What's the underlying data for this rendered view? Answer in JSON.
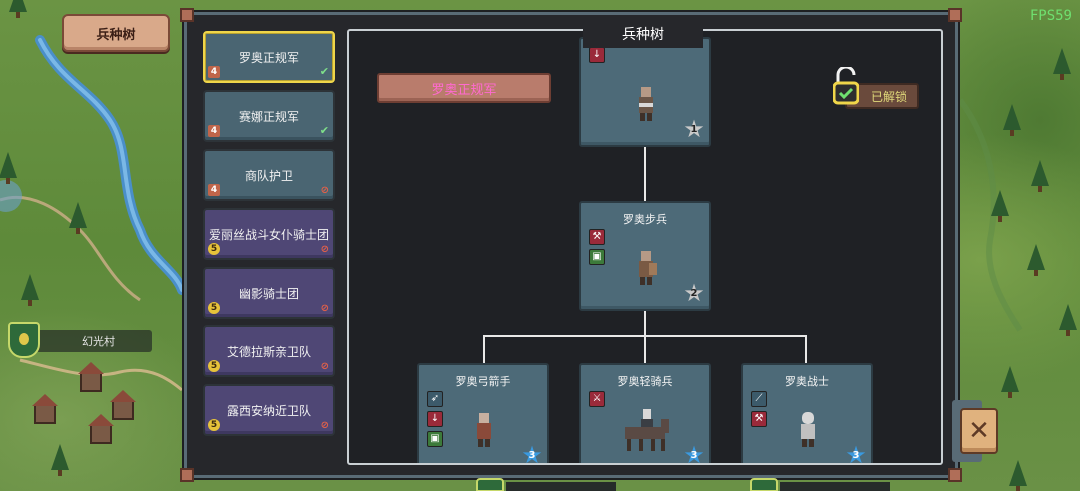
{
  "hud": {
    "top_button": "兵种树",
    "fps": "FPS59"
  },
  "map": {
    "village_name": "幻光村"
  },
  "sidebar": {
    "items": [
      {
        "name": "罗奥正规军",
        "tier": "4",
        "status": "✔",
        "style": "blue",
        "selected": true
      },
      {
        "name": "赛娜正规军",
        "tier": "4",
        "status": "✔",
        "style": "blue",
        "selected": false
      },
      {
        "name": "商队护卫",
        "tier": "4",
        "status": "⊘",
        "style": "blue",
        "selected": false
      },
      {
        "name": "爱丽丝战斗女仆骑士团",
        "tier": "5",
        "status": "⊘",
        "style": "purple",
        "selected": false
      },
      {
        "name": "幽影骑士团",
        "tier": "5",
        "status": "⊘",
        "style": "purple",
        "selected": false
      },
      {
        "name": "艾德拉斯亲卫队",
        "tier": "5",
        "status": "⊘",
        "style": "purple",
        "selected": false
      },
      {
        "name": "露西安纳近卫队",
        "tier": "5",
        "status": "⊘",
        "style": "purple",
        "selected": false
      }
    ]
  },
  "tree": {
    "title": "兵种树",
    "selected_faction": "罗奥正规军",
    "unlock_label": "已解锁",
    "nodes": [
      {
        "name": "",
        "tier": "1",
        "icons": [
          "red"
        ],
        "star": "silver"
      },
      {
        "name": "罗奥步兵",
        "tier": "2",
        "icons": [
          "red",
          "green"
        ],
        "star": "silver"
      },
      {
        "name": "罗奥弓箭手",
        "tier": "3",
        "icons": [
          "slate",
          "red",
          "green"
        ],
        "star": "blue"
      },
      {
        "name": "罗奥轻骑兵",
        "tier": "3",
        "icons": [
          "red"
        ],
        "star": "blue"
      },
      {
        "name": "罗奥战士",
        "tier": "3",
        "icons": [
          "slate",
          "red"
        ],
        "star": "blue"
      }
    ]
  },
  "colors": {
    "accent_selected": "#f0d64a",
    "unlocked_text": "#e0d97a",
    "selected_faction_text": "#ff6ad0"
  },
  "icons": {
    "close": "close-x-icon",
    "unlock": "open-padlock-icon",
    "tier_star": "star-icon"
  }
}
